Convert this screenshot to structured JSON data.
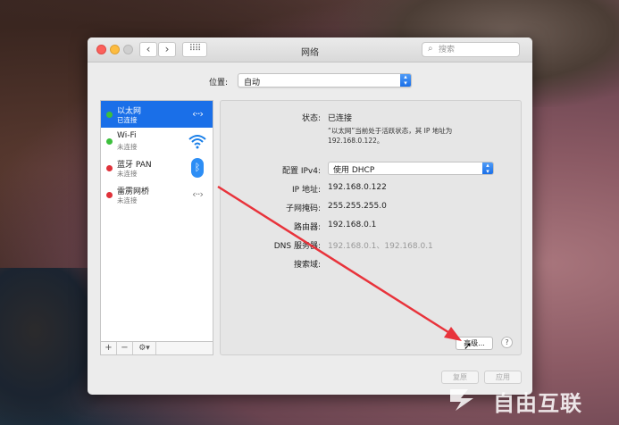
{
  "window": {
    "title": "网络",
    "search_placeholder": "搜索"
  },
  "location": {
    "label": "位置:",
    "value": "自动"
  },
  "services": [
    {
      "name": "以太网",
      "status": "已连接",
      "state": "green",
      "icon": "ethernet-icon",
      "selected": true
    },
    {
      "name": "Wi-Fi",
      "status": "未连接",
      "state": "green",
      "icon": "wifi-icon",
      "selected": false
    },
    {
      "name": "蓝牙 PAN",
      "status": "未连接",
      "state": "red",
      "icon": "bluetooth-icon",
      "selected": false
    },
    {
      "name": "雷雳网桥",
      "status": "未连接",
      "state": "red",
      "icon": "ethernet-icon",
      "selected": false
    }
  ],
  "sidebar_footer": {
    "add": "+",
    "remove": "−",
    "gear": "⚙▾"
  },
  "detail": {
    "status_label": "状态:",
    "status_value": "已连接",
    "status_desc": "“以太网”当前处于活跃状态，其 IP 地址为 192.168.0.122。",
    "ipv4_label": "配置 IPv4:",
    "ipv4_value": "使用 DHCP",
    "ip_label": "IP 地址:",
    "ip_value": "192.168.0.122",
    "mask_label": "子网掩码:",
    "mask_value": "255.255.255.0",
    "router_label": "路由器:",
    "router_value": "192.168.0.1",
    "dns_label": "DNS 服务器:",
    "dns_value": "192.168.0.1、192.168.0.1",
    "search_domain_label": "搜索域:",
    "advanced_button": "高级...",
    "help_button": "?"
  },
  "buttons": {
    "revert": "复原",
    "apply": "应用"
  },
  "watermark": "自由互联",
  "colors": {
    "accent": "#1a6fe8",
    "annotation_arrow": "#e8333b",
    "status_green": "#3cbf3c",
    "status_red": "#e0323a"
  }
}
